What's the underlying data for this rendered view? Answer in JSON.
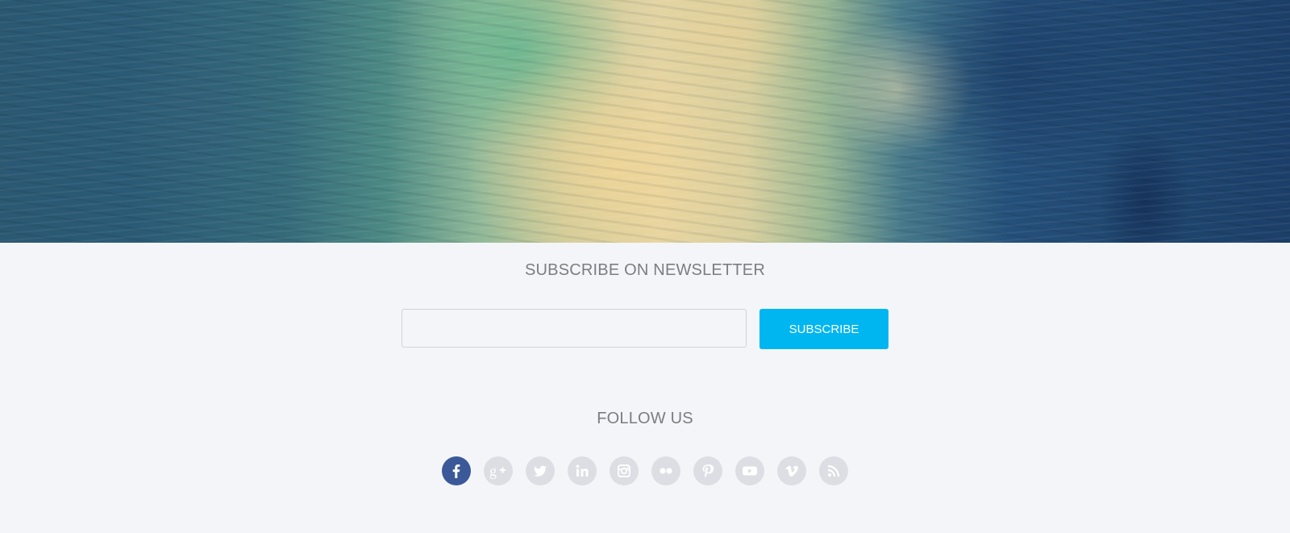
{
  "hero": {
    "image_semantic": "ocean-wake-photo"
  },
  "newsletter": {
    "title": "SUBSCRIBE ON NEWSLETTER",
    "email_value": "",
    "button_label": "SUBSCRIBE"
  },
  "follow": {
    "title": "FOLLOW US",
    "networks": [
      {
        "name": "facebook-icon",
        "active": true
      },
      {
        "name": "google-plus-icon",
        "active": false
      },
      {
        "name": "twitter-icon",
        "active": false
      },
      {
        "name": "linkedin-icon",
        "active": false
      },
      {
        "name": "instagram-icon",
        "active": false
      },
      {
        "name": "flickr-icon",
        "active": false
      },
      {
        "name": "pinterest-icon",
        "active": false
      },
      {
        "name": "youtube-icon",
        "active": false
      },
      {
        "name": "vimeo-icon",
        "active": false
      },
      {
        "name": "rss-icon",
        "active": false
      }
    ]
  },
  "colors": {
    "page_background": "#f3f5f9",
    "accent": "#00b6f1",
    "facebook": "#3b5998",
    "social_inactive": "#dcdee3",
    "heading_text": "#7a7d82"
  }
}
